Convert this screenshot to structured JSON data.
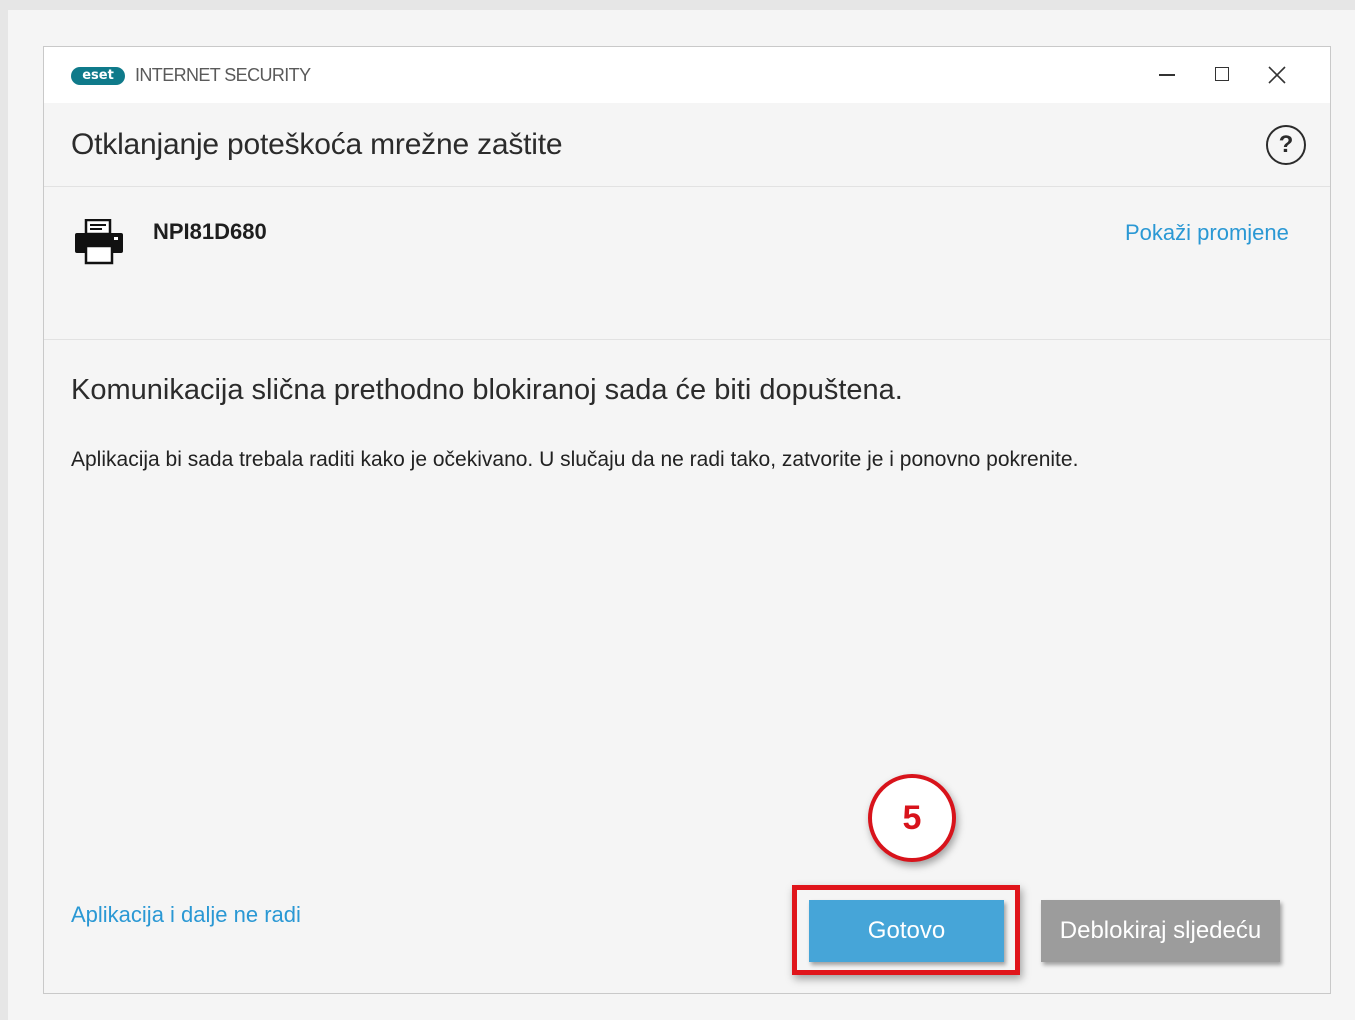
{
  "titlebar": {
    "logo_text": "eset",
    "product_name": "INTERNET SECURITY",
    "controls": {
      "minimize": "minimize-icon",
      "maximize": "maximize-icon",
      "close": "close-icon"
    }
  },
  "header": {
    "title": "Otklanjanje poteškoća mrežne zaštite",
    "help_icon": "?"
  },
  "device": {
    "icon": "printer-icon",
    "name": "NPI81D680",
    "show_changes_link": "Pokaži promjene"
  },
  "content": {
    "headline": "Komunikacija slična prethodno blokiranoj sada će biti dopuštena.",
    "description": "Aplikacija bi sada trebala raditi kako je očekivano. U slučaju da ne radi tako, zatvorite je i ponovno pokrenite."
  },
  "footer": {
    "still_not_working_link": "Aplikacija i dalje ne radi",
    "done_button": "Gotovo",
    "unblock_next_button": "Deblokiraj sljedeću"
  },
  "annotation": {
    "step_number": "5"
  },
  "colors": {
    "accent_link": "#2a98d4",
    "primary_button": "#46a5d8",
    "secondary_button": "#9c9c9c",
    "annotation_red": "#d8131b",
    "eset_brand": "#0f7a8a"
  }
}
